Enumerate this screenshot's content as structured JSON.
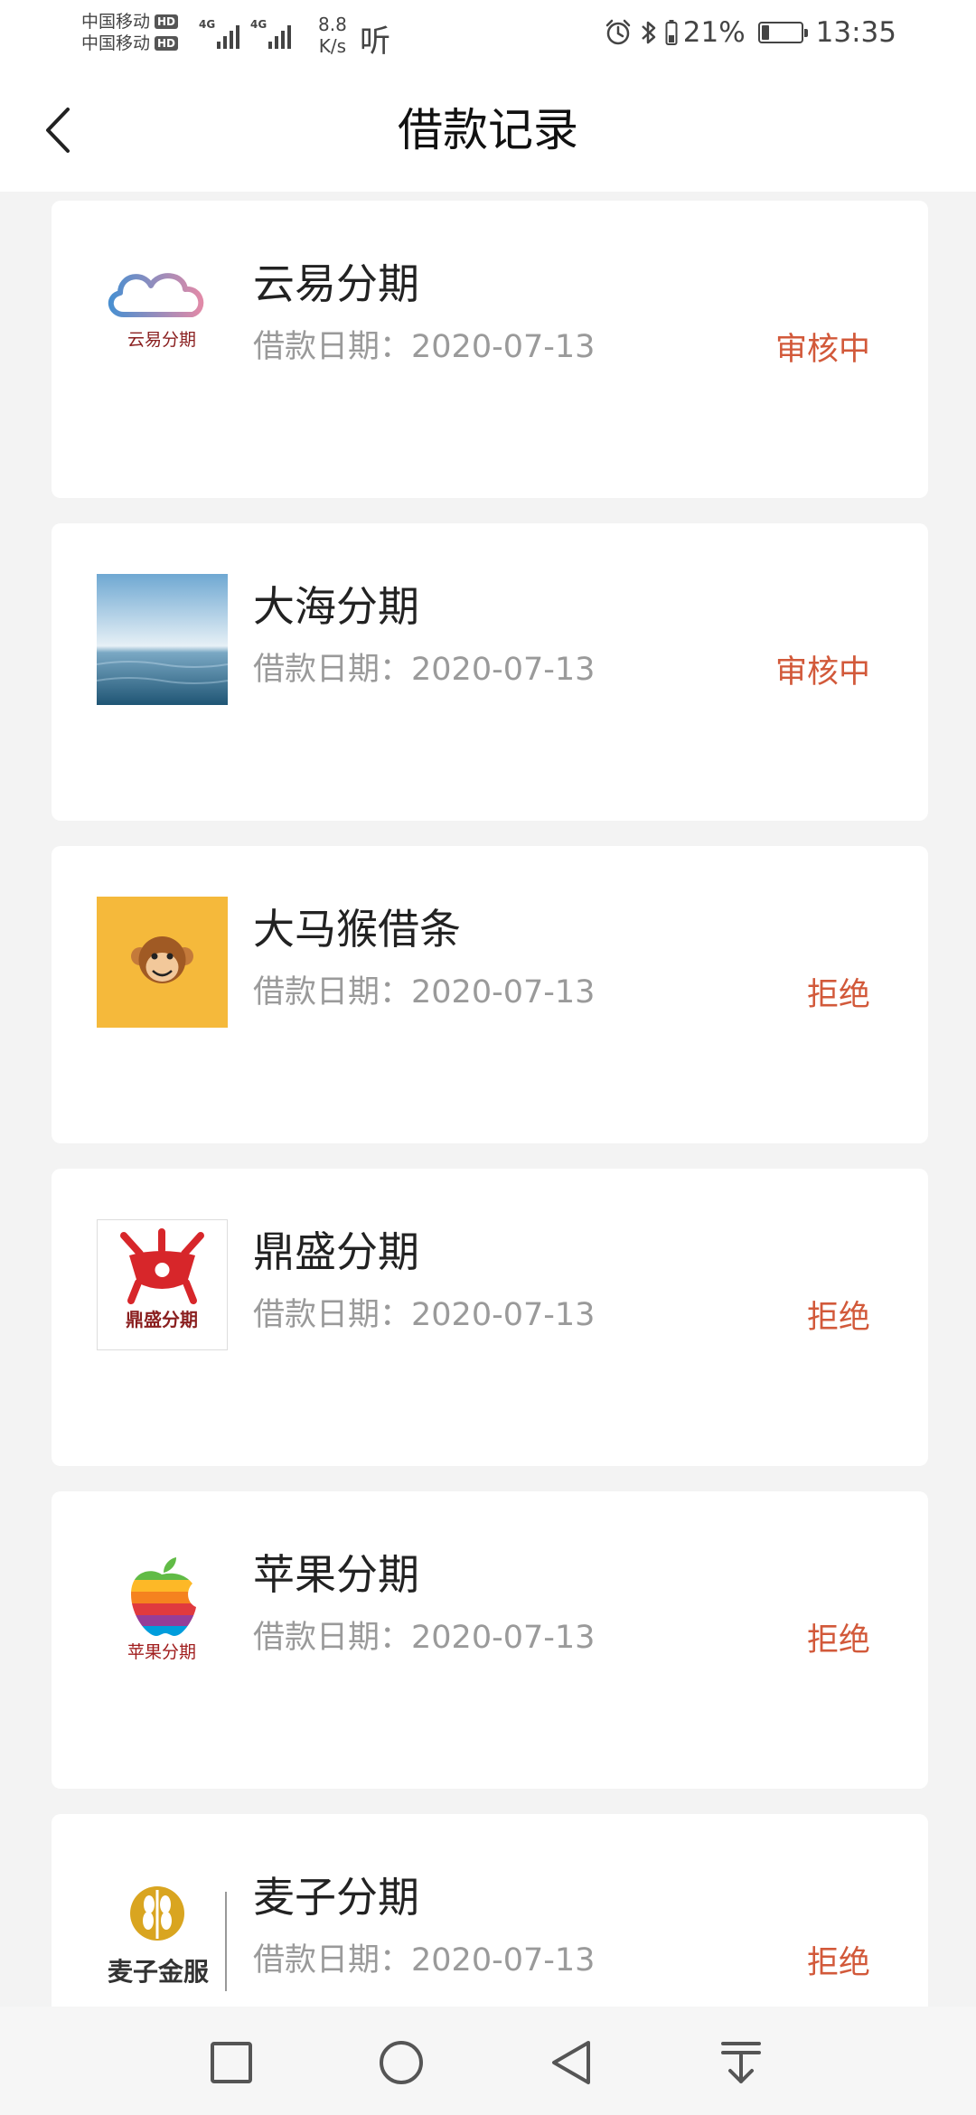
{
  "status_bar": {
    "carrier_1": "中国移动",
    "carrier_2": "中国移动",
    "hd": "HD",
    "network_1": "4G",
    "network_2": "4G",
    "speed_value": "8.8",
    "speed_unit": "K/s",
    "listen_icon": "听",
    "battery_percent": "21%",
    "battery_level": 0.21,
    "time": "13:35"
  },
  "header": {
    "title": "借款记录"
  },
  "loans": [
    {
      "name": "云易分期",
      "date_label": "借款日期：",
      "date": "2020-07-13",
      "status": "审核中",
      "logo_text": "云易分期"
    },
    {
      "name": "大海分期",
      "date_label": "借款日期：",
      "date": "2020-07-13",
      "status": "审核中"
    },
    {
      "name": "大马猴借条",
      "date_label": "借款日期：",
      "date": "2020-07-13",
      "status": "拒绝"
    },
    {
      "name": "鼎盛分期",
      "date_label": "借款日期：",
      "date": "2020-07-13",
      "status": "拒绝",
      "logo_text": "鼎盛分期"
    },
    {
      "name": "苹果分期",
      "date_label": "借款日期：",
      "date": "2020-07-13",
      "status": "拒绝",
      "logo_text": "苹果分期"
    },
    {
      "name": "麦子分期",
      "date_label": "借款日期：",
      "date": "2020-07-13",
      "status": "拒绝",
      "logo_text": "麦子金服"
    }
  ],
  "colors": {
    "status_accent": "#d2593a",
    "page_background": "#f3f3f3"
  },
  "icons": {
    "back": "chevron-left-icon",
    "nav_recent": "square-icon",
    "nav_home": "circle-icon",
    "nav_back": "triangle-left-icon",
    "nav_notifications": "pull-down-icon"
  }
}
